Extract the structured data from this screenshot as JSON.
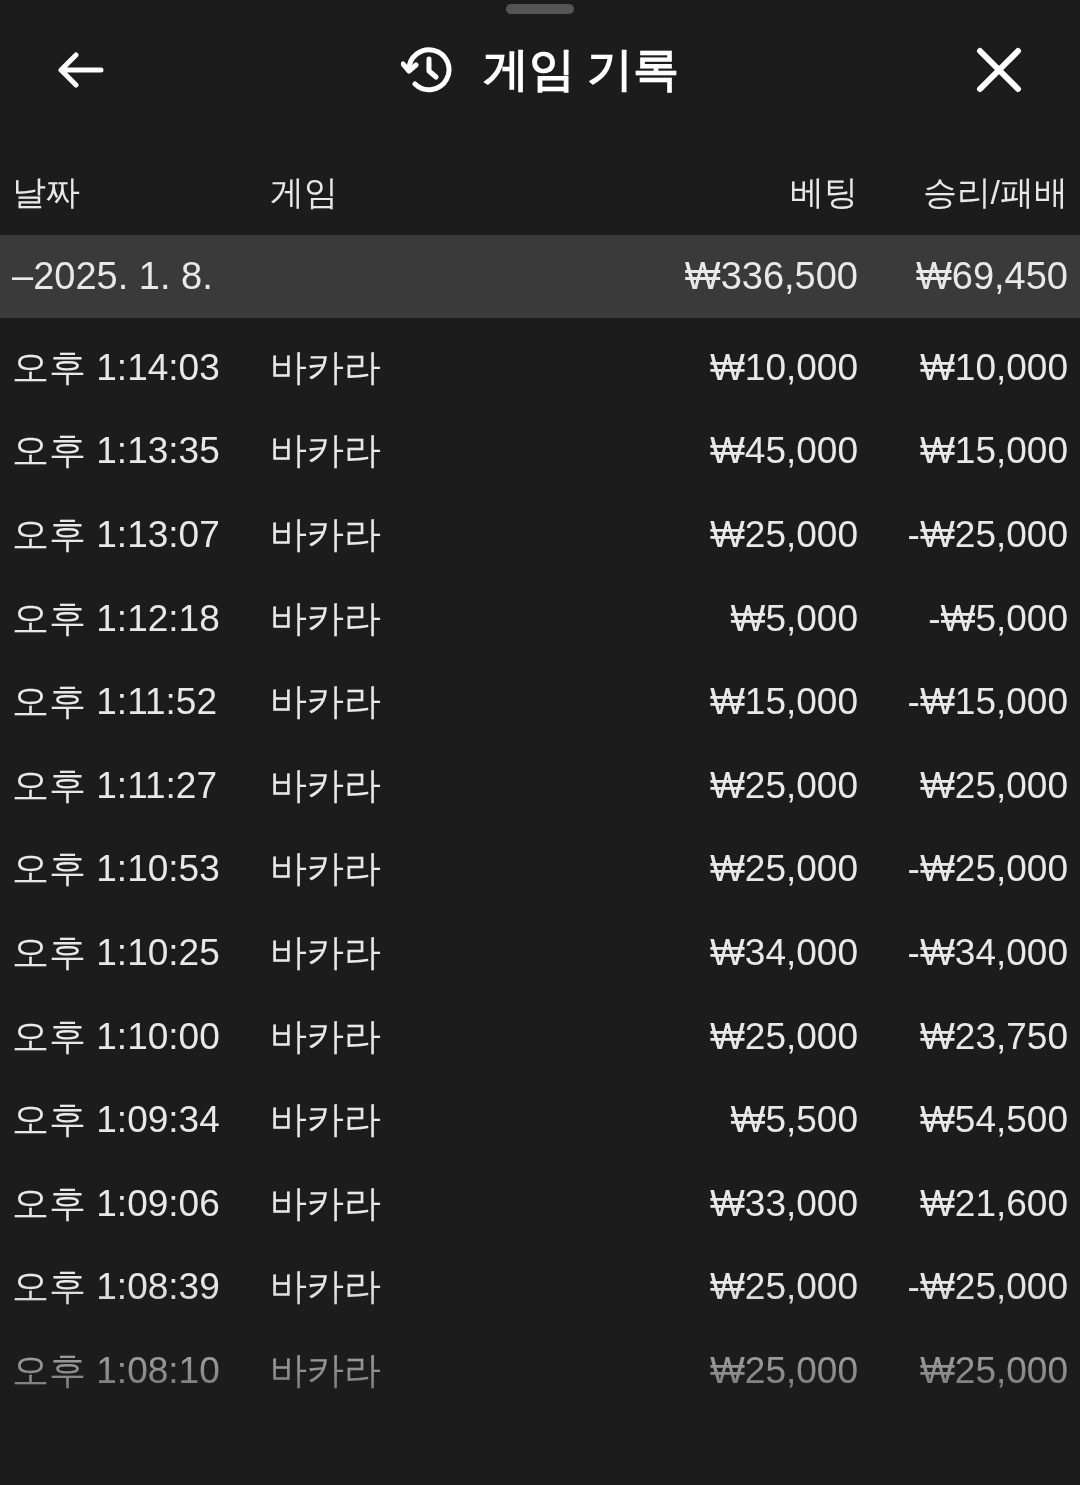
{
  "header": {
    "title": "게임 기록"
  },
  "columns": [
    "날짜",
    "게임",
    "베팅",
    "승리/패배"
  ],
  "group": {
    "date": "–2025. 1. 8.",
    "bet": "₩336,500",
    "result": "₩69,450"
  },
  "rows": [
    {
      "time": "오후 1:14:03",
      "game": "바카라",
      "bet": "₩10,000",
      "result": "₩10,000"
    },
    {
      "time": "오후 1:13:35",
      "game": "바카라",
      "bet": "₩45,000",
      "result": "₩15,000"
    },
    {
      "time": "오후 1:13:07",
      "game": "바카라",
      "bet": "₩25,000",
      "result": "-₩25,000"
    },
    {
      "time": "오후 1:12:18",
      "game": "바카라",
      "bet": "₩5,000",
      "result": "-₩5,000"
    },
    {
      "time": "오후 1:11:52",
      "game": "바카라",
      "bet": "₩15,000",
      "result": "-₩15,000"
    },
    {
      "time": "오후 1:11:27",
      "game": "바카라",
      "bet": "₩25,000",
      "result": "₩25,000"
    },
    {
      "time": "오후 1:10:53",
      "game": "바카라",
      "bet": "₩25,000",
      "result": "-₩25,000"
    },
    {
      "time": "오후 1:10:25",
      "game": "바카라",
      "bet": "₩34,000",
      "result": "-₩34,000"
    },
    {
      "time": "오후 1:10:00",
      "game": "바카라",
      "bet": "₩25,000",
      "result": "₩23,750"
    },
    {
      "time": "오후 1:09:34",
      "game": "바카라",
      "bet": "₩5,500",
      "result": "₩54,500"
    },
    {
      "time": "오후 1:09:06",
      "game": "바카라",
      "bet": "₩33,000",
      "result": "₩21,600"
    },
    {
      "time": "오후 1:08:39",
      "game": "바카라",
      "bet": "₩25,000",
      "result": "-₩25,000"
    },
    {
      "time": "오후 1:08:10",
      "game": "바카라",
      "bet": "₩25,000",
      "result": "₩25,000"
    }
  ]
}
